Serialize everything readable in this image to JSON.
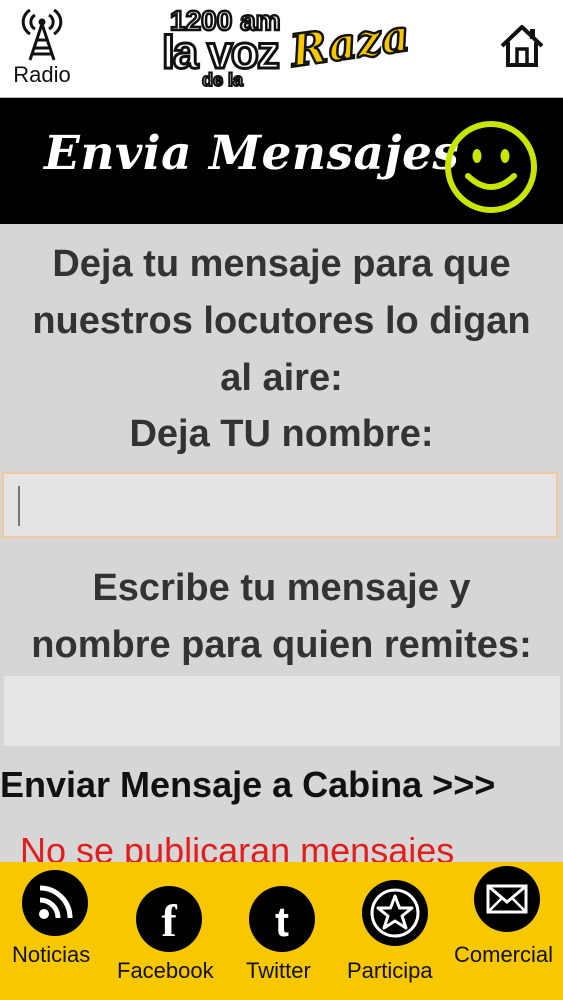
{
  "header": {
    "radio_label": "Radio",
    "logo_text": "1200 am la voz de la Raza"
  },
  "hero": {
    "title": "Envia Mensajes"
  },
  "form": {
    "prompt_intro_line1": "Deja tu mensaje para que",
    "prompt_intro_line2": "nuestros locutores lo digan",
    "prompt_intro_line3": "al aire:",
    "name_label": "Deja TU nombre:",
    "name_value": "",
    "message_label_line1": "Escribe tu mensaje y",
    "message_label_line2": "nombre para quien remites:",
    "message_value": "",
    "send_label": "Enviar Mensaje a Cabina >>>",
    "notice": "No se publicaran mensajes"
  },
  "bottom_nav": [
    {
      "label": "Noticias",
      "icon": "rss-icon"
    },
    {
      "label": "Facebook",
      "icon": "facebook-icon"
    },
    {
      "label": "Twitter",
      "icon": "twitter-icon"
    },
    {
      "label": "Participa",
      "icon": "star-icon"
    },
    {
      "label": "Comercial",
      "icon": "mail-icon"
    }
  ],
  "colors": {
    "accent_yellow": "#f7c700",
    "smiley_green": "#c8e600",
    "notice_red": "#e21d1d",
    "hero_bg": "#000000"
  }
}
